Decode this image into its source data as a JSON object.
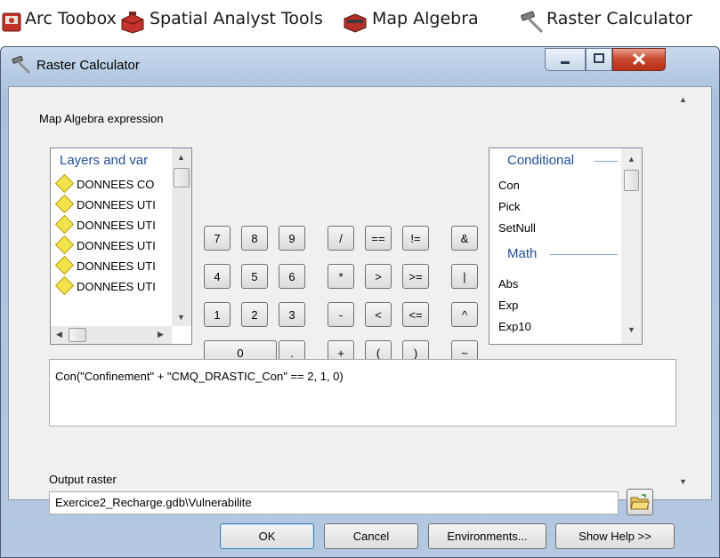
{
  "breadcrumb": [
    {
      "label": "Arc Toobox",
      "icon": "toolbox-icon"
    },
    {
      "label": "Spatial Analyst Tools",
      "icon": "toolbox-icon"
    },
    {
      "label": "Map Algebra",
      "icon": "toolset-icon"
    },
    {
      "label": "Raster Calculator",
      "icon": "hammer-icon"
    }
  ],
  "window": {
    "title": "Raster Calculator",
    "controls": {
      "minimize": "minimize",
      "maximize": "maximize",
      "close": "close"
    }
  },
  "expression_section": {
    "label": "Map Algebra expression"
  },
  "layers": {
    "header": "Layers and var",
    "items": [
      "DONNEES CO",
      "DONNEES UTI",
      "DONNEES UTI",
      "DONNEES UTI",
      "DONNEES UTI",
      "DONNEES UTI"
    ]
  },
  "keypad": {
    "numbers": [
      [
        "7",
        "8",
        "9"
      ],
      [
        "4",
        "5",
        "6"
      ],
      [
        "1",
        "2",
        "3"
      ]
    ],
    "zero": "0",
    "dot": ".",
    "operators": [
      [
        "/",
        "==",
        "!=",
        "&"
      ],
      [
        "*",
        ">",
        ">=",
        "|"
      ],
      [
        "-",
        "<",
        "<=",
        "^"
      ],
      [
        "+",
        "(",
        ")",
        "~"
      ]
    ]
  },
  "functions": {
    "group1": "Conditional",
    "group1_items": [
      "Con",
      "Pick",
      "SetNull"
    ],
    "group2": "Math",
    "group2_items": [
      "Abs",
      "Exp",
      "Exp10"
    ]
  },
  "expression": {
    "value": "Con(\"Confinement\" + \"CMQ_DRASTIC_Con\" == 2, 1, 0)"
  },
  "output": {
    "label": "Output raster",
    "value": "Exercice2_Recharge.gdb\\Vulnerabilite"
  },
  "buttons": {
    "ok": "OK",
    "cancel": "Cancel",
    "environments": "Environments...",
    "show_help": "Show Help >>"
  },
  "colors": {
    "accent": "#1f4e96",
    "title_gradient": "#b6cbe3",
    "close_red": "#c8442c",
    "layer_icon": "#f2e34a"
  }
}
